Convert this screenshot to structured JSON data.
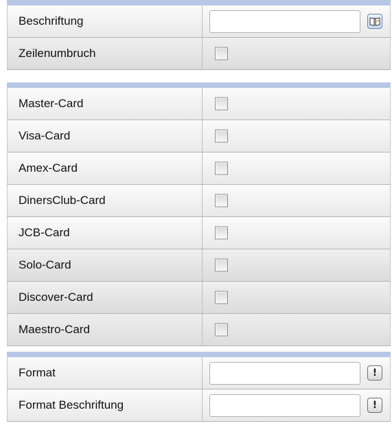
{
  "section_general": {
    "caption_label": "Beschriftung",
    "caption_value": "",
    "caption_button_icon": "book-icon",
    "linebreak_label": "Zeilenumbruch",
    "linebreak_checked": false
  },
  "section_cards": {
    "items": [
      {
        "label": "Master-Card",
        "checked": false
      },
      {
        "label": "Visa-Card",
        "checked": false
      },
      {
        "label": "Amex-Card",
        "checked": false
      },
      {
        "label": "DinersClub-Card",
        "checked": false
      },
      {
        "label": "JCB-Card",
        "checked": false
      },
      {
        "label": "Solo-Card",
        "checked": false
      },
      {
        "label": "Discover-Card",
        "checked": false
      },
      {
        "label": "Maestro-Card",
        "checked": false
      }
    ]
  },
  "section_format": {
    "format_label": "Format",
    "format_value": "",
    "format_button_icon": "exclamation-icon",
    "format_caption_label": "Format Beschriftung",
    "format_caption_value": "",
    "format_caption_button_icon": "exclamation-icon",
    "button_glyph": "!"
  },
  "colors": {
    "section_border": "#b6c8e6",
    "row_light": "#fbfbfb",
    "row_dark": "#e9e9e9"
  }
}
